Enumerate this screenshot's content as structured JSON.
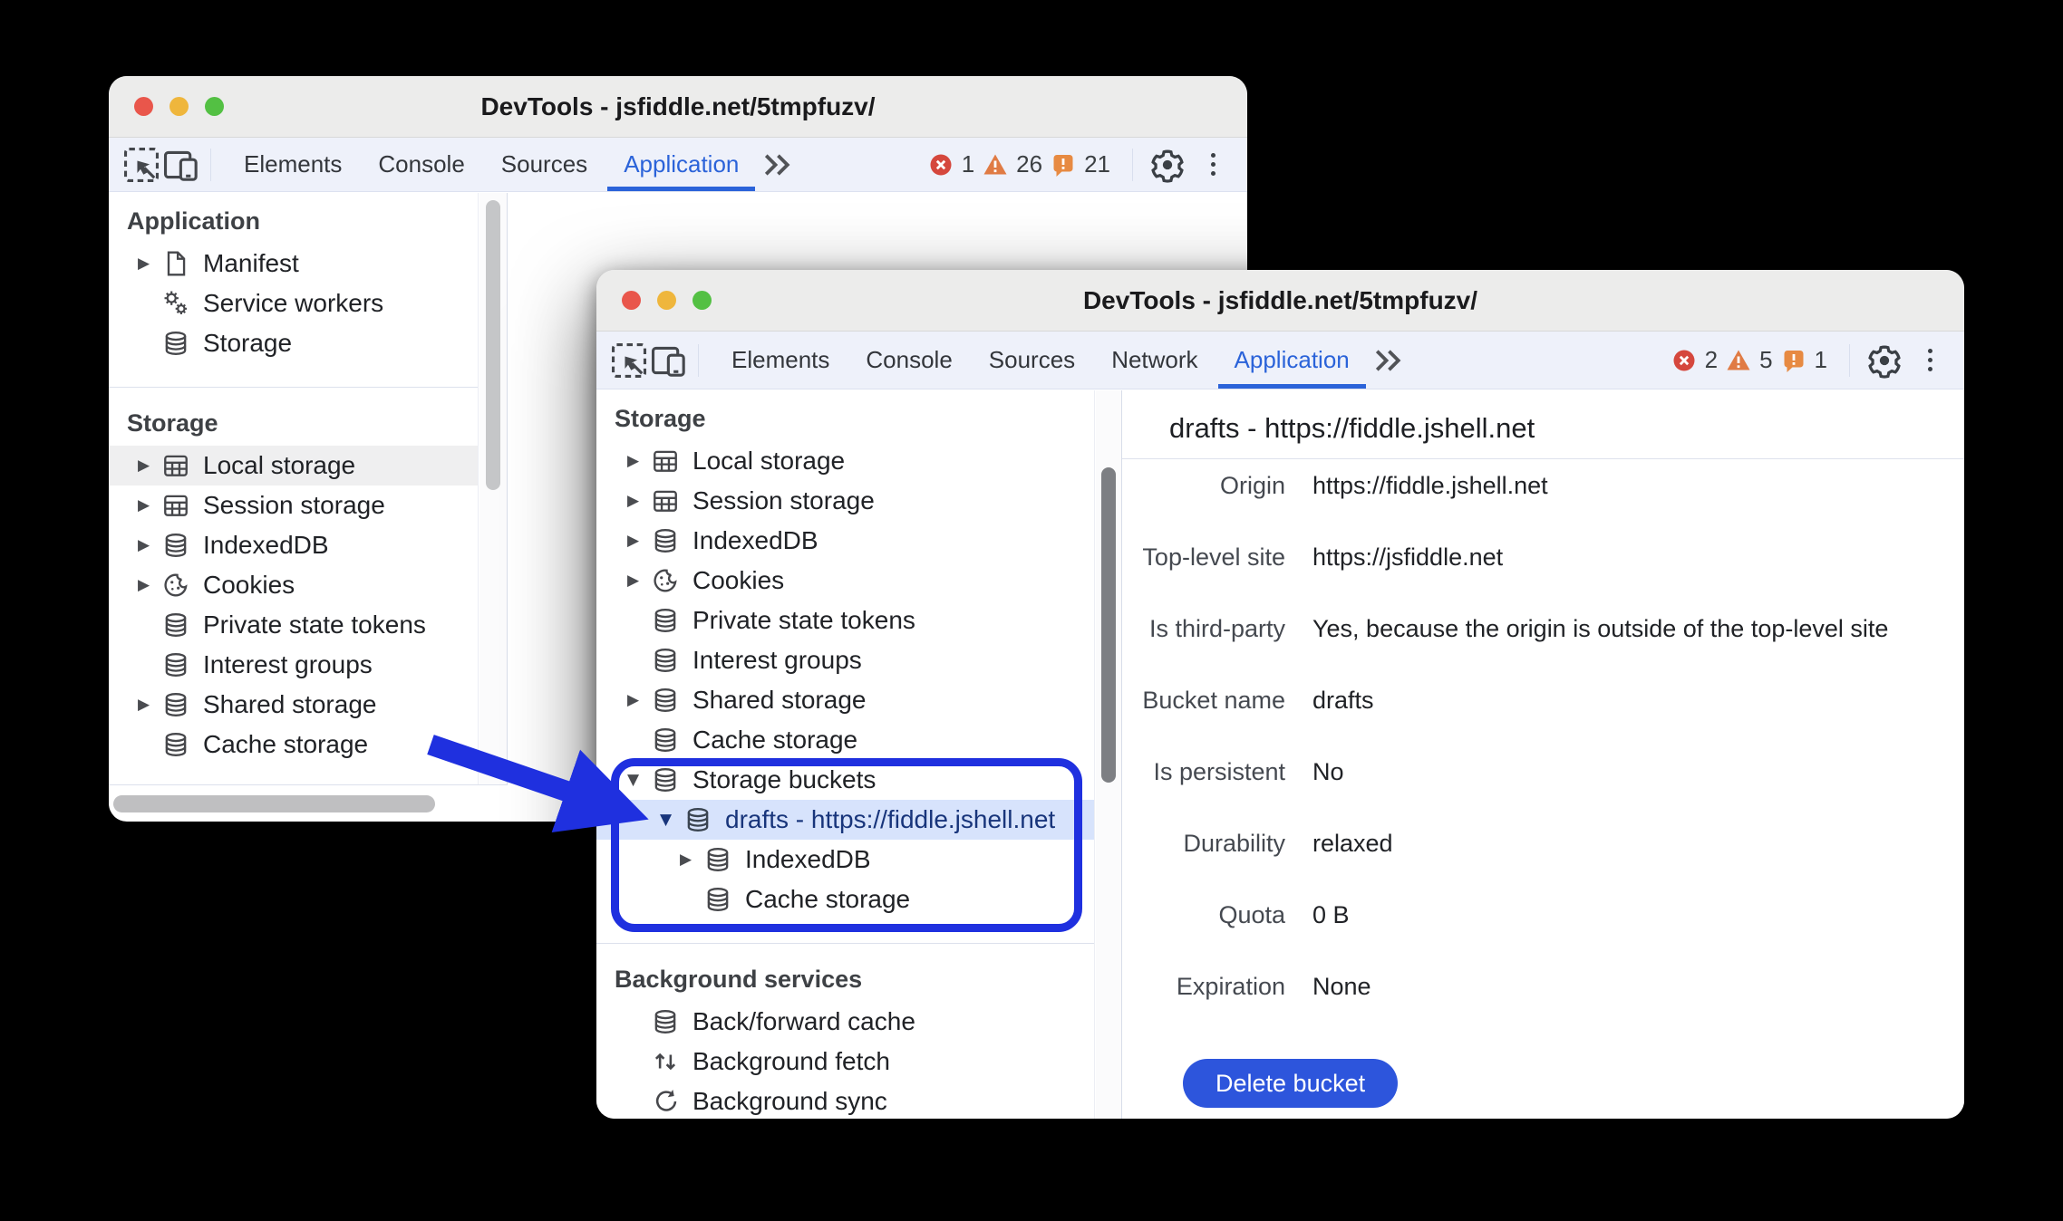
{
  "colors": {
    "accent_blue": "#2b63d9",
    "highlight_blue": "#1f30df",
    "selection_bg": "#d7e3fc",
    "selection_text": "#18357b",
    "error_red": "#d5473d",
    "warning_orange": "#e07b44",
    "issue_orange": "#e78a42",
    "button_blue": "#2d55dc"
  },
  "windows": [
    {
      "title": "DevTools - jsfiddle.net/5tmpfuzv/",
      "tabs": [
        {
          "label": "Elements"
        },
        {
          "label": "Console"
        },
        {
          "label": "Sources"
        },
        {
          "label": "Application",
          "active": true
        }
      ],
      "badges": [
        {
          "kind": "error",
          "count": "1"
        },
        {
          "kind": "warning",
          "count": "26"
        },
        {
          "kind": "issue",
          "count": "21"
        }
      ],
      "sidebar": {
        "sections": [
          {
            "header": "Application",
            "items": [
              {
                "label": "Manifest",
                "icon": "doc",
                "expander": "right",
                "level": 0
              },
              {
                "label": "Service workers",
                "icon": "gears",
                "expander": null,
                "level": 0
              },
              {
                "label": "Storage",
                "icon": "db",
                "expander": null,
                "level": 0
              }
            ]
          },
          {
            "header": "Storage",
            "items": [
              {
                "label": "Local storage",
                "icon": "table",
                "expander": "right",
                "level": 0,
                "dim": true
              },
              {
                "label": "Session storage",
                "icon": "table",
                "expander": "right",
                "level": 0
              },
              {
                "label": "IndexedDB",
                "icon": "db",
                "expander": "right",
                "level": 0
              },
              {
                "label": "Cookies",
                "icon": "cookie",
                "expander": "right",
                "level": 0
              },
              {
                "label": "Private state tokens",
                "icon": "db",
                "expander": null,
                "level": 0
              },
              {
                "label": "Interest groups",
                "icon": "db",
                "expander": null,
                "level": 0
              },
              {
                "label": "Shared storage",
                "icon": "db",
                "expander": "right",
                "level": 0
              },
              {
                "label": "Cache storage",
                "icon": "db",
                "expander": null,
                "level": 0
              }
            ]
          }
        ]
      }
    },
    {
      "title": "DevTools - jsfiddle.net/5tmpfuzv/",
      "tabs": [
        {
          "label": "Elements"
        },
        {
          "label": "Console"
        },
        {
          "label": "Sources"
        },
        {
          "label": "Network"
        },
        {
          "label": "Application",
          "active": true
        }
      ],
      "badges": [
        {
          "kind": "error",
          "count": "2"
        },
        {
          "kind": "warning",
          "count": "5"
        },
        {
          "kind": "issue",
          "count": "1"
        }
      ],
      "sidebar": {
        "sections": [
          {
            "header": "Storage",
            "items": [
              {
                "label": "Local storage",
                "icon": "table",
                "expander": "right",
                "level": 0
              },
              {
                "label": "Session storage",
                "icon": "table",
                "expander": "right",
                "level": 0
              },
              {
                "label": "IndexedDB",
                "icon": "db",
                "expander": "right",
                "level": 0
              },
              {
                "label": "Cookies",
                "icon": "cookie",
                "expander": "right",
                "level": 0
              },
              {
                "label": "Private state tokens",
                "icon": "db",
                "expander": null,
                "level": 0
              },
              {
                "label": "Interest groups",
                "icon": "db",
                "expander": null,
                "level": 0
              },
              {
                "label": "Shared storage",
                "icon": "db",
                "expander": "right",
                "level": 0
              },
              {
                "label": "Cache storage",
                "icon": "db",
                "expander": null,
                "level": 0
              },
              {
                "label": "Storage buckets",
                "icon": "db",
                "expander": "down",
                "level": 0
              },
              {
                "label": "drafts - https://fiddle.jshell.net",
                "icon": "db",
                "expander": "down",
                "level": 1,
                "selected": true
              },
              {
                "label": "IndexedDB",
                "icon": "db",
                "expander": "right",
                "level": 2
              },
              {
                "label": "Cache storage",
                "icon": "db",
                "expander": null,
                "level": 2
              }
            ]
          },
          {
            "header": "Background services",
            "items": [
              {
                "label": "Back/forward cache",
                "icon": "db",
                "expander": null,
                "level": 0
              },
              {
                "label": "Background fetch",
                "icon": "fetch",
                "expander": null,
                "level": 0
              },
              {
                "label": "Background sync",
                "icon": "sync",
                "expander": null,
                "level": 0
              }
            ]
          }
        ]
      },
      "detail": {
        "title": "drafts - https://fiddle.jshell.net",
        "rows": [
          {
            "label": "Origin",
            "value": "https://fiddle.jshell.net"
          },
          {
            "label": "Top-level site",
            "value": "https://jsfiddle.net"
          },
          {
            "label": "Is third-party",
            "value": "Yes, because the origin is outside of the top-level site"
          },
          {
            "label": "Bucket name",
            "value": "drafts"
          },
          {
            "label": "Is persistent",
            "value": "No"
          },
          {
            "label": "Durability",
            "value": "relaxed"
          },
          {
            "label": "Quota",
            "value": "0 B"
          },
          {
            "label": "Expiration",
            "value": "None"
          }
        ],
        "button_label": "Delete bucket"
      }
    }
  ]
}
